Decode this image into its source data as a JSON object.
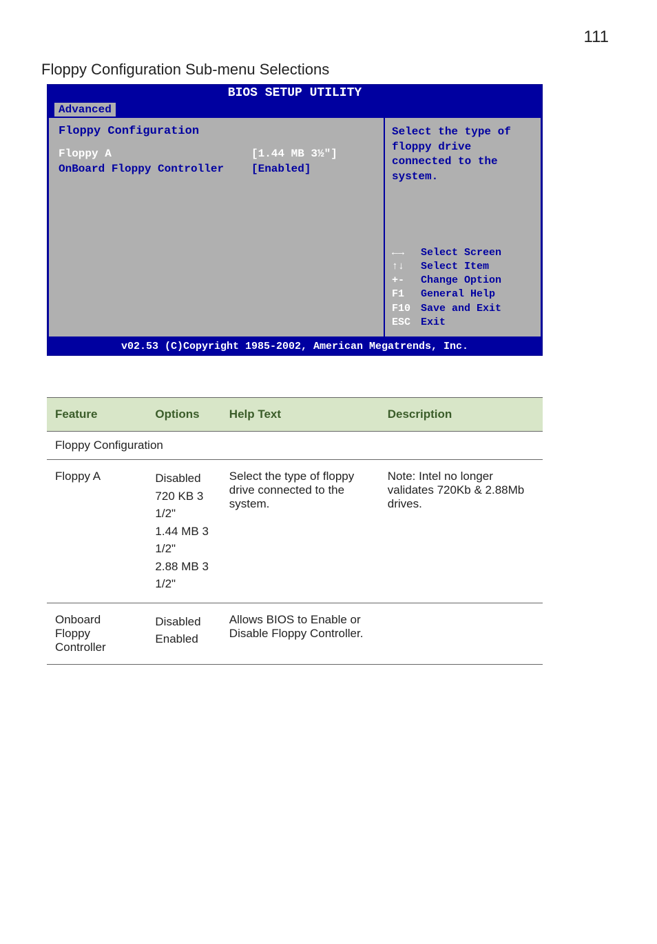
{
  "page_number": "111",
  "section_title": "Floppy Configuration Sub-menu Selections",
  "bios": {
    "banner": "BIOS SETUP UTILITY",
    "tab": "Advanced",
    "heading": "Floppy Configuration",
    "rows": [
      {
        "label": "Floppy A",
        "value": "[1.44 MB 3½\"]"
      },
      {
        "label": "OnBoard Floppy Controller",
        "value": "[Enabled]"
      }
    ],
    "help": "Select the type of floppy drive connected to the system.",
    "legend": [
      {
        "k": "←→",
        "d": "Select Screen"
      },
      {
        "k": "↑↓",
        "d": "Select Item"
      },
      {
        "k": "+-",
        "d": "Change Option"
      },
      {
        "k": "F1",
        "d": "General Help"
      },
      {
        "k": "F10",
        "d": "Save and Exit"
      },
      {
        "k": "ESC",
        "d": "Exit"
      }
    ],
    "footer": "v02.53 (C)Copyright 1985-2002, American Megatrends, Inc."
  },
  "table": {
    "headers": [
      "Feature",
      "Options",
      "Help Text",
      "Description"
    ],
    "section": "Floppy Configuration",
    "rows": [
      {
        "feature": "Floppy A",
        "options": [
          "Disabled",
          "720 KB 3 1/2\"",
          "1.44 MB 3 1/2\"",
          "2.88 MB 3 1/2\""
        ],
        "help": "Select the type of floppy drive connected to the system.",
        "desc": "Note:  Intel no longer validates 720Kb & 2.88Mb drives."
      },
      {
        "feature": "Onboard Floppy Controller",
        "options": [
          "Disabled",
          "Enabled"
        ],
        "help": "Allows BIOS to Enable or Disable Floppy Controller.",
        "desc": ""
      }
    ]
  },
  "chart_data": {
    "type": "table",
    "title": "Floppy Configuration Sub-menu Selections",
    "columns": [
      "Feature",
      "Options",
      "Help Text",
      "Description"
    ],
    "rows": [
      [
        "Floppy A",
        "Disabled; 720 KB 3 1/2\"; 1.44 MB 3 1/2\"; 2.88 MB 3 1/2\"",
        "Select the type of floppy drive connected to the system.",
        "Note: Intel no longer validates 720Kb & 2.88Mb drives."
      ],
      [
        "Onboard Floppy Controller",
        "Disabled; Enabled",
        "Allows BIOS to Enable or Disable Floppy Controller.",
        ""
      ]
    ]
  }
}
